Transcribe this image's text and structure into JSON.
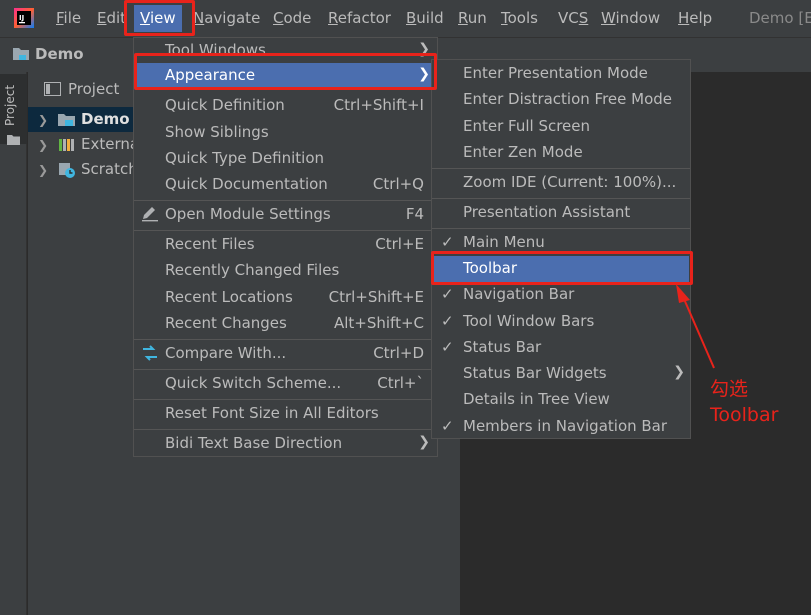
{
  "menubar": {
    "items": [
      {
        "label": "File",
        "mnemonic": "F",
        "rest": "ile"
      },
      {
        "label": "Edit",
        "mnemonic": "E",
        "rest": "dit"
      },
      {
        "label": "View",
        "mnemonic": "V",
        "rest": "iew"
      },
      {
        "label": "Navigate",
        "mnemonic": "N",
        "rest": "avigate"
      },
      {
        "label": "Code",
        "mnemonic": "C",
        "rest": "ode"
      },
      {
        "label": "Refactor",
        "mnemonic": "R",
        "rest": "efactor"
      },
      {
        "label": "Build",
        "mnemonic": "B",
        "rest": "uild"
      },
      {
        "label": "Run",
        "mnemonic": "R",
        "rest": "un"
      },
      {
        "label": "Tools",
        "mnemonic": "T",
        "rest": "ools"
      },
      {
        "label": "VCS",
        "mnemonic": "S",
        "rest": "VC"
      },
      {
        "label": "Window",
        "mnemonic": "W",
        "rest": "indow"
      },
      {
        "label": "Help",
        "mnemonic": "H",
        "rest": "elp"
      }
    ],
    "window_title": "Demo [E"
  },
  "navbar": {
    "project_name": "Demo"
  },
  "stripe": {
    "project_tab": "Project"
  },
  "project_panel": {
    "header": "Project",
    "tree": [
      {
        "label": "Demo"
      },
      {
        "label": "External"
      },
      {
        "label": "Scratch"
      }
    ]
  },
  "view_menu": {
    "items": [
      {
        "label": "Tool Windows",
        "shortcut": ""
      },
      {
        "label": "Appearance",
        "shortcut": ""
      },
      {
        "label": "Quick Definition",
        "shortcut": "Ctrl+Shift+I"
      },
      {
        "label": "Show Siblings",
        "shortcut": ""
      },
      {
        "label": "Quick Type Definition",
        "shortcut": ""
      },
      {
        "label": "Quick Documentation",
        "shortcut": "Ctrl+Q"
      },
      {
        "label": "Open Module Settings",
        "shortcut": "F4"
      },
      {
        "label": "Recent Files",
        "shortcut": "Ctrl+E"
      },
      {
        "label": "Recently Changed Files",
        "shortcut": ""
      },
      {
        "label": "Recent Locations",
        "shortcut": "Ctrl+Shift+E"
      },
      {
        "label": "Recent Changes",
        "shortcut": "Alt+Shift+C"
      },
      {
        "label": "Compare With...",
        "shortcut": "Ctrl+D"
      },
      {
        "label": "Quick Switch Scheme...",
        "shortcut": "Ctrl+`"
      },
      {
        "label": "Reset Font Size in All Editors",
        "shortcut": ""
      },
      {
        "label": "Bidi Text Base Direction",
        "shortcut": ""
      }
    ]
  },
  "appearance_submenu": {
    "items": [
      {
        "label": "Enter Presentation Mode",
        "checked": ""
      },
      {
        "label": "Enter Distraction Free Mode",
        "checked": ""
      },
      {
        "label": "Enter Full Screen",
        "checked": ""
      },
      {
        "label": "Enter Zen Mode",
        "checked": ""
      },
      {
        "label": "Zoom IDE (Current: 100%)...",
        "checked": ""
      },
      {
        "label": "Presentation Assistant",
        "checked": ""
      },
      {
        "label": "Main Menu",
        "checked": "✓"
      },
      {
        "label": "Toolbar",
        "checked": ""
      },
      {
        "label": "Navigation Bar",
        "checked": "✓"
      },
      {
        "label": "Tool Window Bars",
        "checked": "✓"
      },
      {
        "label": "Status Bar",
        "checked": "✓"
      },
      {
        "label": "Status Bar Widgets",
        "checked": ""
      },
      {
        "label": "Details in Tree View",
        "checked": ""
      },
      {
        "label": "Members in Navigation Bar",
        "checked": "✓"
      }
    ]
  },
  "annotation": {
    "line1": "勾选",
    "line2": "Toolbar",
    "color": "#e8231b"
  },
  "colors": {
    "menubar_bg": "#3c3f41",
    "highlight": "#4b6eaf",
    "editor_bg": "#2b2b2b",
    "selection": "#0d293e"
  }
}
